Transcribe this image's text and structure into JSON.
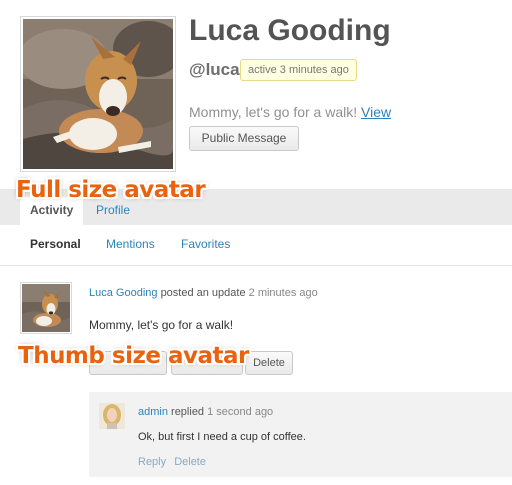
{
  "profile": {
    "display_name": "Luca Gooding",
    "handle": "@luca",
    "activity_badge": "active 3 minutes ago",
    "latest_update": "Mommy, let's go for a walk!",
    "view_link": "View",
    "public_message_button": "Public Message"
  },
  "item_nav": {
    "tabs": [
      {
        "label": "Activity",
        "selected": true
      },
      {
        "label": "Profile",
        "selected": false
      }
    ]
  },
  "subnav": {
    "items": [
      {
        "label": "Personal",
        "selected": true
      },
      {
        "label": "Mentions",
        "selected": false
      },
      {
        "label": "Favorites",
        "selected": false
      }
    ]
  },
  "activity": {
    "author": "Luca Gooding",
    "action": "posted an update",
    "time": "2 minutes ago",
    "content": "Mommy, let's go for a walk!",
    "buttons": {
      "delete": "Delete"
    },
    "comment": {
      "author": "admin",
      "action": "replied",
      "time": "1 second ago",
      "text": "Ok, but first I need a cup of coffee.",
      "reply": "Reply",
      "delete": "Delete"
    }
  },
  "annotations": {
    "full_avatar": "Full size avatar",
    "thumb_avatar": "Thumb size avatar"
  },
  "colors": {
    "link": "#2b84bb",
    "callout": "#e8620f",
    "badge_bg": "#ffffe2",
    "nav_bg": "#eaeaea",
    "comment_bg": "#f2f2f2"
  }
}
